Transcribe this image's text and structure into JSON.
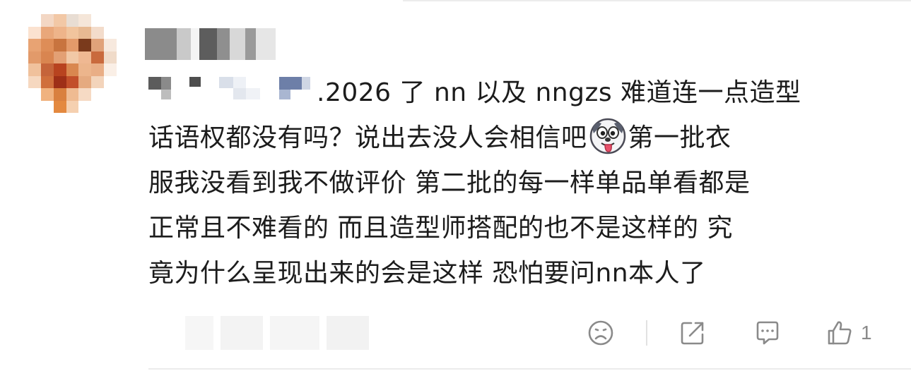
{
  "comment": {
    "text_line1": ".2026 了 nn 以及 nngzs 难道连一点造型",
    "text_line2_a": "话语权都没有吗？说出去没人会相信吧",
    "text_line2_b": "第一批衣",
    "text_line3": "服我没看到我不做评价 第二批的每一样单品单看都是",
    "text_line4": "正常且不难看的 而且造型师搭配的也不是这样的 究",
    "text_line5": "竟为什么呈现出来的会是这样 恐怕要问nn本人了",
    "emoji": "dog-tongue-emoji"
  },
  "actions": {
    "dislike_icon": "sad-face-icon",
    "share_icon": "share-icon",
    "reply_icon": "comment-icon",
    "like_icon": "thumbs-up-icon",
    "like_count": "1"
  },
  "colors": {
    "text": "#1c1c1c",
    "icon": "#8a8a8a",
    "divider": "#ececec"
  }
}
